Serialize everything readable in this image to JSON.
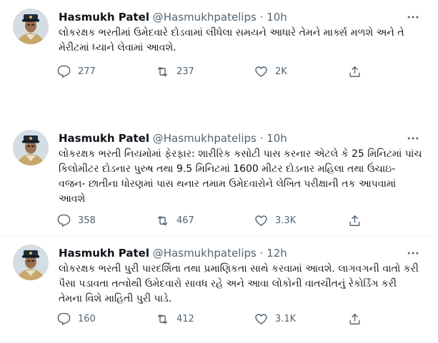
{
  "tweets": [
    {
      "name": "Hasmukh Patel",
      "handle": "@Hasmukhpatelips",
      "dot": "·",
      "time": "10h",
      "text": "લોકરક્ષક ભરતીમાં ઉમેદવારે દોડવામાં લીધેલા સમયને આધારે તેમને માર્ક્સ મળશે અને તે મેરીટમાં ધ્યાને લેવામાં આવશે.",
      "replies": "277",
      "retweets": "237",
      "likes": "2K"
    },
    {
      "name": "Hasmukh Patel",
      "handle": "@Hasmukhpatelips",
      "dot": "·",
      "time": "10h",
      "text": "લોકરક્ષક ભરતી નિયમોમાં ફેરફાર: શારીરિક કસોટી પાસ કરનાર એટલે કે 25 મિનિટમાં પાંચ કિલોમીટર દોડનાર પુરુષ તથા 9.5 મિનિટમાં 1600 મીટર દોડનાર મહિલા તથા ઉંચાઇ- વજન- છાતીના ધોરણમાં પાસ થનાર તમામ ઉમેદવારોને લેખિત પરીક્ષાની તક આપવામાં આવશે",
      "replies": "358",
      "retweets": "467",
      "likes": "3.3K"
    },
    {
      "name": "Hasmukh Patel",
      "handle": "@Hasmukhpatelips",
      "dot": "·",
      "time": "12h",
      "text": "લોકરક્ષક ભરતી પુરી પારદર્શિતા તથા પ્રમાણિકતા સાથે કરવામાં આવશે. લાગવગની વાતો કરી પૈસા પડાવતા તત્વોથી ઉમેદવારો સાવધ રહે અને આવા લોકોની વાતચીતનું રેકોર્ડિંગ કરી તેમના વિશે માહિતી પુરી પાડે.",
      "replies": "160",
      "retweets": "412",
      "likes": "3.1K"
    }
  ],
  "colors": {
    "text": "#0f1419",
    "secondary": "#536471",
    "border": "#eff3f4"
  },
  "icons": {
    "reply": "reply-icon",
    "retweet": "retweet-icon",
    "like": "heart-icon",
    "share": "share-icon",
    "more": "more-icon"
  }
}
